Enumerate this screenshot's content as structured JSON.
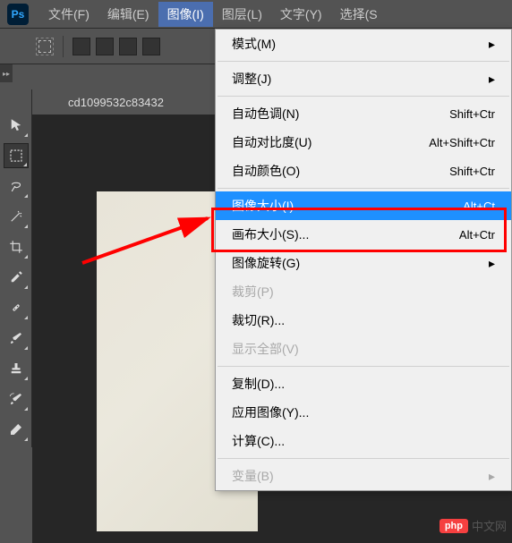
{
  "logo": "Ps",
  "menubar": {
    "file": "文件(F)",
    "edit": "编辑(E)",
    "image": "图像(I)",
    "layer": "图层(L)",
    "type": "文字(Y)",
    "select": "选择(S"
  },
  "doc_tab": "cd1099532c83432",
  "dropdown": {
    "mode": "模式(M)",
    "adjust": "调整(J)",
    "auto_tone": {
      "label": "自动色调(N)",
      "shortcut": "Shift+Ctr"
    },
    "auto_contrast": {
      "label": "自动对比度(U)",
      "shortcut": "Alt+Shift+Ctr"
    },
    "auto_color": {
      "label": "自动颜色(O)",
      "shortcut": "Shift+Ctr"
    },
    "image_size": {
      "label": "图像大小(I)...",
      "shortcut": "Alt+Ct"
    },
    "canvas_size": {
      "label": "画布大小(S)...",
      "shortcut": "Alt+Ctr"
    },
    "rotate": "图像旋转(G)",
    "crop": "裁剪(P)",
    "trim": "裁切(R)...",
    "reveal": "显示全部(V)",
    "duplicate": "复制(D)...",
    "apply_image": "应用图像(Y)...",
    "calc": "计算(C)...",
    "variable": "变量(B)"
  },
  "watermark": {
    "badge": "php",
    "text": "中文网"
  }
}
